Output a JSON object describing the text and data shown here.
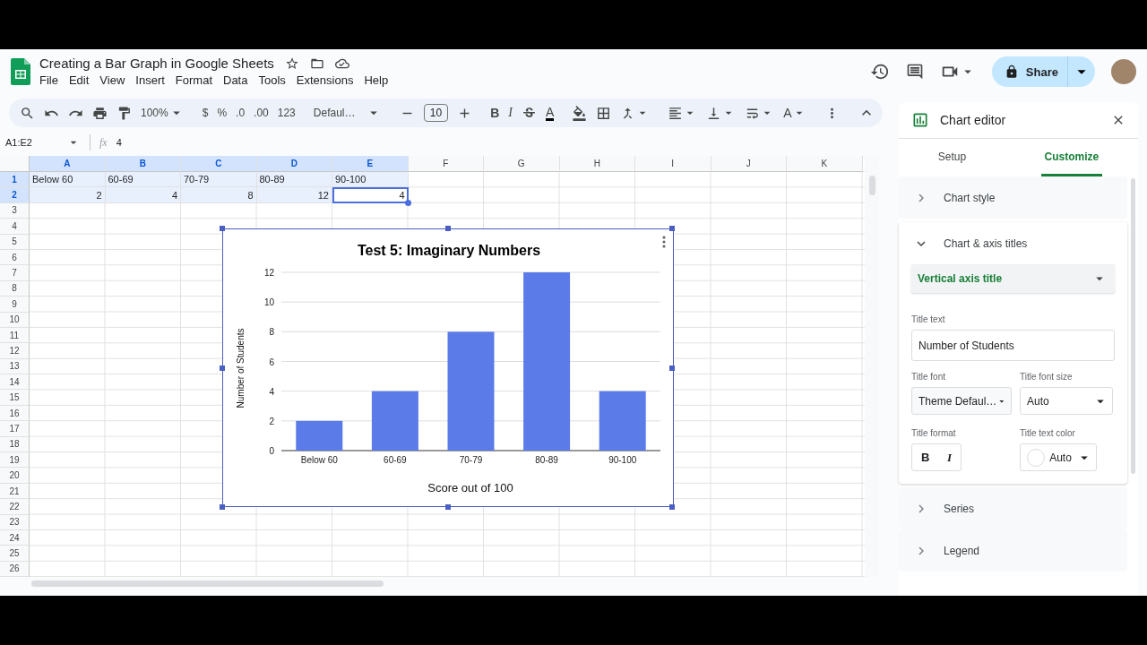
{
  "document": {
    "title": "Creating a Bar Graph in Google Sheets"
  },
  "menu": [
    "File",
    "Edit",
    "View",
    "Insert",
    "Format",
    "Data",
    "Tools",
    "Extensions",
    "Help"
  ],
  "share_button": {
    "label": "Share"
  },
  "toolbar": {
    "zoom": "100%",
    "currency": "$",
    "percent": "%",
    "decrease_decimal": ".0",
    "increase_decimal": ".00",
    "number_format": "123",
    "font": "Defaul…",
    "font_size": "10",
    "bold": "B",
    "italic": "I",
    "text_color": "A",
    "text_rotation": "A"
  },
  "formula_bar": {
    "name_box": "A1:E2",
    "fx": "fx",
    "value": "4"
  },
  "sheet": {
    "columns": [
      {
        "label": "A",
        "selected": true
      },
      {
        "label": "B",
        "selected": true
      },
      {
        "label": "C",
        "selected": true
      },
      {
        "label": "D",
        "selected": true
      },
      {
        "label": "E",
        "selected": true
      },
      {
        "label": "F",
        "selected": false
      },
      {
        "label": "G",
        "selected": false
      },
      {
        "label": "H",
        "selected": false
      },
      {
        "label": "I",
        "selected": false
      },
      {
        "label": "J",
        "selected": false
      },
      {
        "label": "K",
        "selected": false
      }
    ],
    "rows": [
      {
        "label": "1",
        "selected": true,
        "cells": [
          {
            "text": "Below 60",
            "kind": "text",
            "active": false
          },
          {
            "text": "60-69",
            "kind": "text",
            "active": false
          },
          {
            "text": "70-79",
            "kind": "text",
            "active": false
          },
          {
            "text": "80-89",
            "kind": "text",
            "active": false
          },
          {
            "text": "90-100",
            "kind": "text",
            "active": false
          }
        ]
      },
      {
        "label": "2",
        "selected": true,
        "cells": [
          {
            "text": "2",
            "kind": "number",
            "active": false
          },
          {
            "text": "4",
            "kind": "number",
            "active": false
          },
          {
            "text": "8",
            "kind": "number",
            "active": false
          },
          {
            "text": "12",
            "kind": "number",
            "active": false
          },
          {
            "text": "4",
            "kind": "number",
            "active": true
          }
        ]
      },
      {
        "label": "3",
        "selected": false
      },
      {
        "label": "4",
        "selected": false
      },
      {
        "label": "5",
        "selected": false
      },
      {
        "label": "6",
        "selected": false
      },
      {
        "label": "7",
        "selected": false
      },
      {
        "label": "8",
        "selected": false
      },
      {
        "label": "9",
        "selected": false
      },
      {
        "label": "10",
        "selected": false
      },
      {
        "label": "11",
        "selected": false
      },
      {
        "label": "12",
        "selected": false
      },
      {
        "label": "13",
        "selected": false
      },
      {
        "label": "14",
        "selected": false
      },
      {
        "label": "15",
        "selected": false
      },
      {
        "label": "16",
        "selected": false
      },
      {
        "label": "17",
        "selected": false
      },
      {
        "label": "18",
        "selected": false
      },
      {
        "label": "19",
        "selected": false
      },
      {
        "label": "20",
        "selected": false
      },
      {
        "label": "21",
        "selected": false
      },
      {
        "label": "22",
        "selected": false
      },
      {
        "label": "23",
        "selected": false
      },
      {
        "label": "24",
        "selected": false
      },
      {
        "label": "25",
        "selected": false
      },
      {
        "label": "26",
        "selected": false
      }
    ]
  },
  "chart": {
    "chart_data": {
      "type": "bar",
      "title": "Test 5: Imaginary Numbers",
      "xlabel": "Score out of 100",
      "ylabel": "Number of Students",
      "categories": [
        "Below 60",
        "60-69",
        "70-79",
        "80-89",
        "90-100"
      ],
      "series": [
        {
          "color": "#5b7be9",
          "values": [
            2,
            4,
            8,
            12,
            4
          ]
        }
      ],
      "ylim": [
        0,
        12
      ],
      "yticks": [
        0,
        2,
        4,
        6,
        8,
        10,
        12
      ],
      "grid": true
    }
  },
  "chart_editor": {
    "title": "Chart editor",
    "tabs": [
      {
        "label": "Setup",
        "selected": false
      },
      {
        "label": "Customize",
        "selected": true
      }
    ],
    "sections": [
      {
        "label": "Chart style",
        "expanded": false
      },
      {
        "label": "Chart & axis titles",
        "expanded": true,
        "content": {
          "target": "Vertical axis title",
          "title_text_label": "Title text",
          "title_text": "Number of Students",
          "title_font_label": "Title font",
          "title_font": "Theme Defaul…",
          "title_font_size_label": "Title font size",
          "title_font_size": "Auto",
          "title_format_label": "Title format",
          "bold": "B",
          "italic": "I",
          "title_text_color_label": "Title text color",
          "title_text_color": "Auto"
        }
      },
      {
        "label": "Series",
        "expanded": false
      },
      {
        "label": "Legend",
        "expanded": false
      }
    ]
  }
}
